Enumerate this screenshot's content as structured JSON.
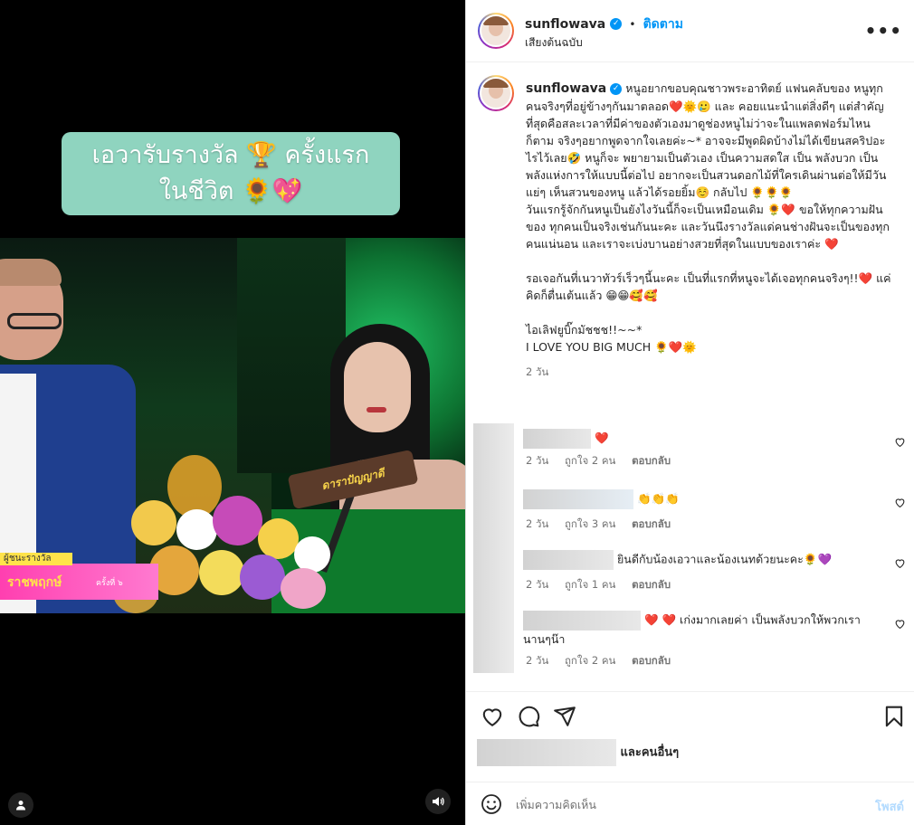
{
  "media": {
    "caption_line1": "เอวารับรางวัล 🏆 ครั้งแรก",
    "caption_line2": "ในชีวิต 🌻💖",
    "podium_logo": "ดาราปัญญาดี",
    "lower_third_top": "ผู้ชนะรางวัล",
    "lower_third_main": "ราชพฤกษ์",
    "lower_third_ep": "ครั้งที่ ๖",
    "user_icon": "person-icon",
    "sound_icon": "speaker-icon"
  },
  "header": {
    "username": "sunflowava",
    "verified_icon": "verified-badge-icon",
    "dot": "•",
    "follow_label": "ติดตาม",
    "audio_label": "เสียงต้นฉบับ",
    "more_icon": "more-options-icon",
    "more_label": "•••"
  },
  "caption": {
    "username": "sunflowava",
    "paragraphs": [
      "หนูอยากขอบคุณชาวพระอาทิตย์ แฟนคลับของ หนูทุกคนจริงๆที่อยู่ข้างๆกันมาตลอด❤️🌞🥲 และ คอยแนะนำแต่สิ่งดีๆ แต่สำคัญที่สุดคือสละเวลาที่มีค่าของตัวเองมาดูช่องหนูไม่ว่าจะในแพลตฟอร์มไหนก็ตาม จริงๆอยากพูดจากใจเลยค่ะ~* อาจจะมีพูดผิดบ้างไม่ได้เขียนสคริปอะไรไว้เลย🤣 หนูก็จะ พยายามเป็นตัวเอง เป็นความสดใส เป็น พลังบวก เป็นพลังแห่งการให้แบบนี้ต่อไป อยากจะเป็นสวนดอกไม้ที่ใครเดินผ่านต่อให้มีวันแย่ๆ เห็นสวนของหนู แล้วได้รอยยิ้ม☺️ กลับไป 🌻🌻🌻",
      "วันแรกรู้จักกันหนูเป็นยังไงวันนี้ก็จะเป็นเหมือนเดิม 🌻❤️ ขอให้ทุกความฝันของ ทุกคนเป็นจริงเช่นกันนะคะ และวันนึงรางวัลแด่คนช่างฝันจะเป็นของทุกคนแน่นอน และเราจะเบ่งบานอย่างสวยที่สุดในแบบของเราค่ะ ❤️",
      "",
      "รอเจอกันที่เนวาทัวร์เร็วๆนี้นะคะ เป็นที่แรกที่หนูจะได้เจอทุกคนจริงๆ!!❤️ แค่คิดก็ตื่นเต้นแล้ว 😁😁🥰🥰",
      "",
      "ไอเลิฟยูบิ๊กมัชชช!!~~*",
      "I LOVE YOU BIG MUCH 🌻❤️🌞"
    ],
    "time": "2 วัน"
  },
  "comments": [
    {
      "text": "❤️",
      "time": "2 วัน",
      "likes": "ถูกใจ 2 คน",
      "reply": "ตอบกลับ"
    },
    {
      "text": "👏👏👏",
      "time": "2 วัน",
      "likes": "ถูกใจ 3 คน",
      "reply": "ตอบกลับ"
    },
    {
      "text": "ยินดีกับน้องเอวาและน้องเนทด้วยนะคะ🌻💜",
      "time": "2 วัน",
      "likes": "ถูกใจ 1 คน",
      "reply": "ตอบกลับ"
    },
    {
      "text": "❤️ ❤️ เก่งมากเลยค่า เป็นพลังบวกให้พวกเรานานๆน๊า",
      "time": "2 วัน",
      "likes": "ถูกใจ 2 คน",
      "reply": "ตอบกลับ"
    }
  ],
  "actions": {
    "like_icon": "heart-icon",
    "comment_icon": "comment-icon",
    "share_icon": "share-icon",
    "save_icon": "bookmark-icon",
    "liked_by_suffix": "และคนอื่นๆ"
  },
  "composer": {
    "emoji_icon": "emoji-icon",
    "placeholder": "เพิ่มความคิดเห็น",
    "post_label": "โพสต์"
  },
  "colors": {
    "accent": "#0095f6",
    "post_disabled": "#b3dbff",
    "meta": "#737373",
    "caption_box": "#8fd4bf"
  }
}
